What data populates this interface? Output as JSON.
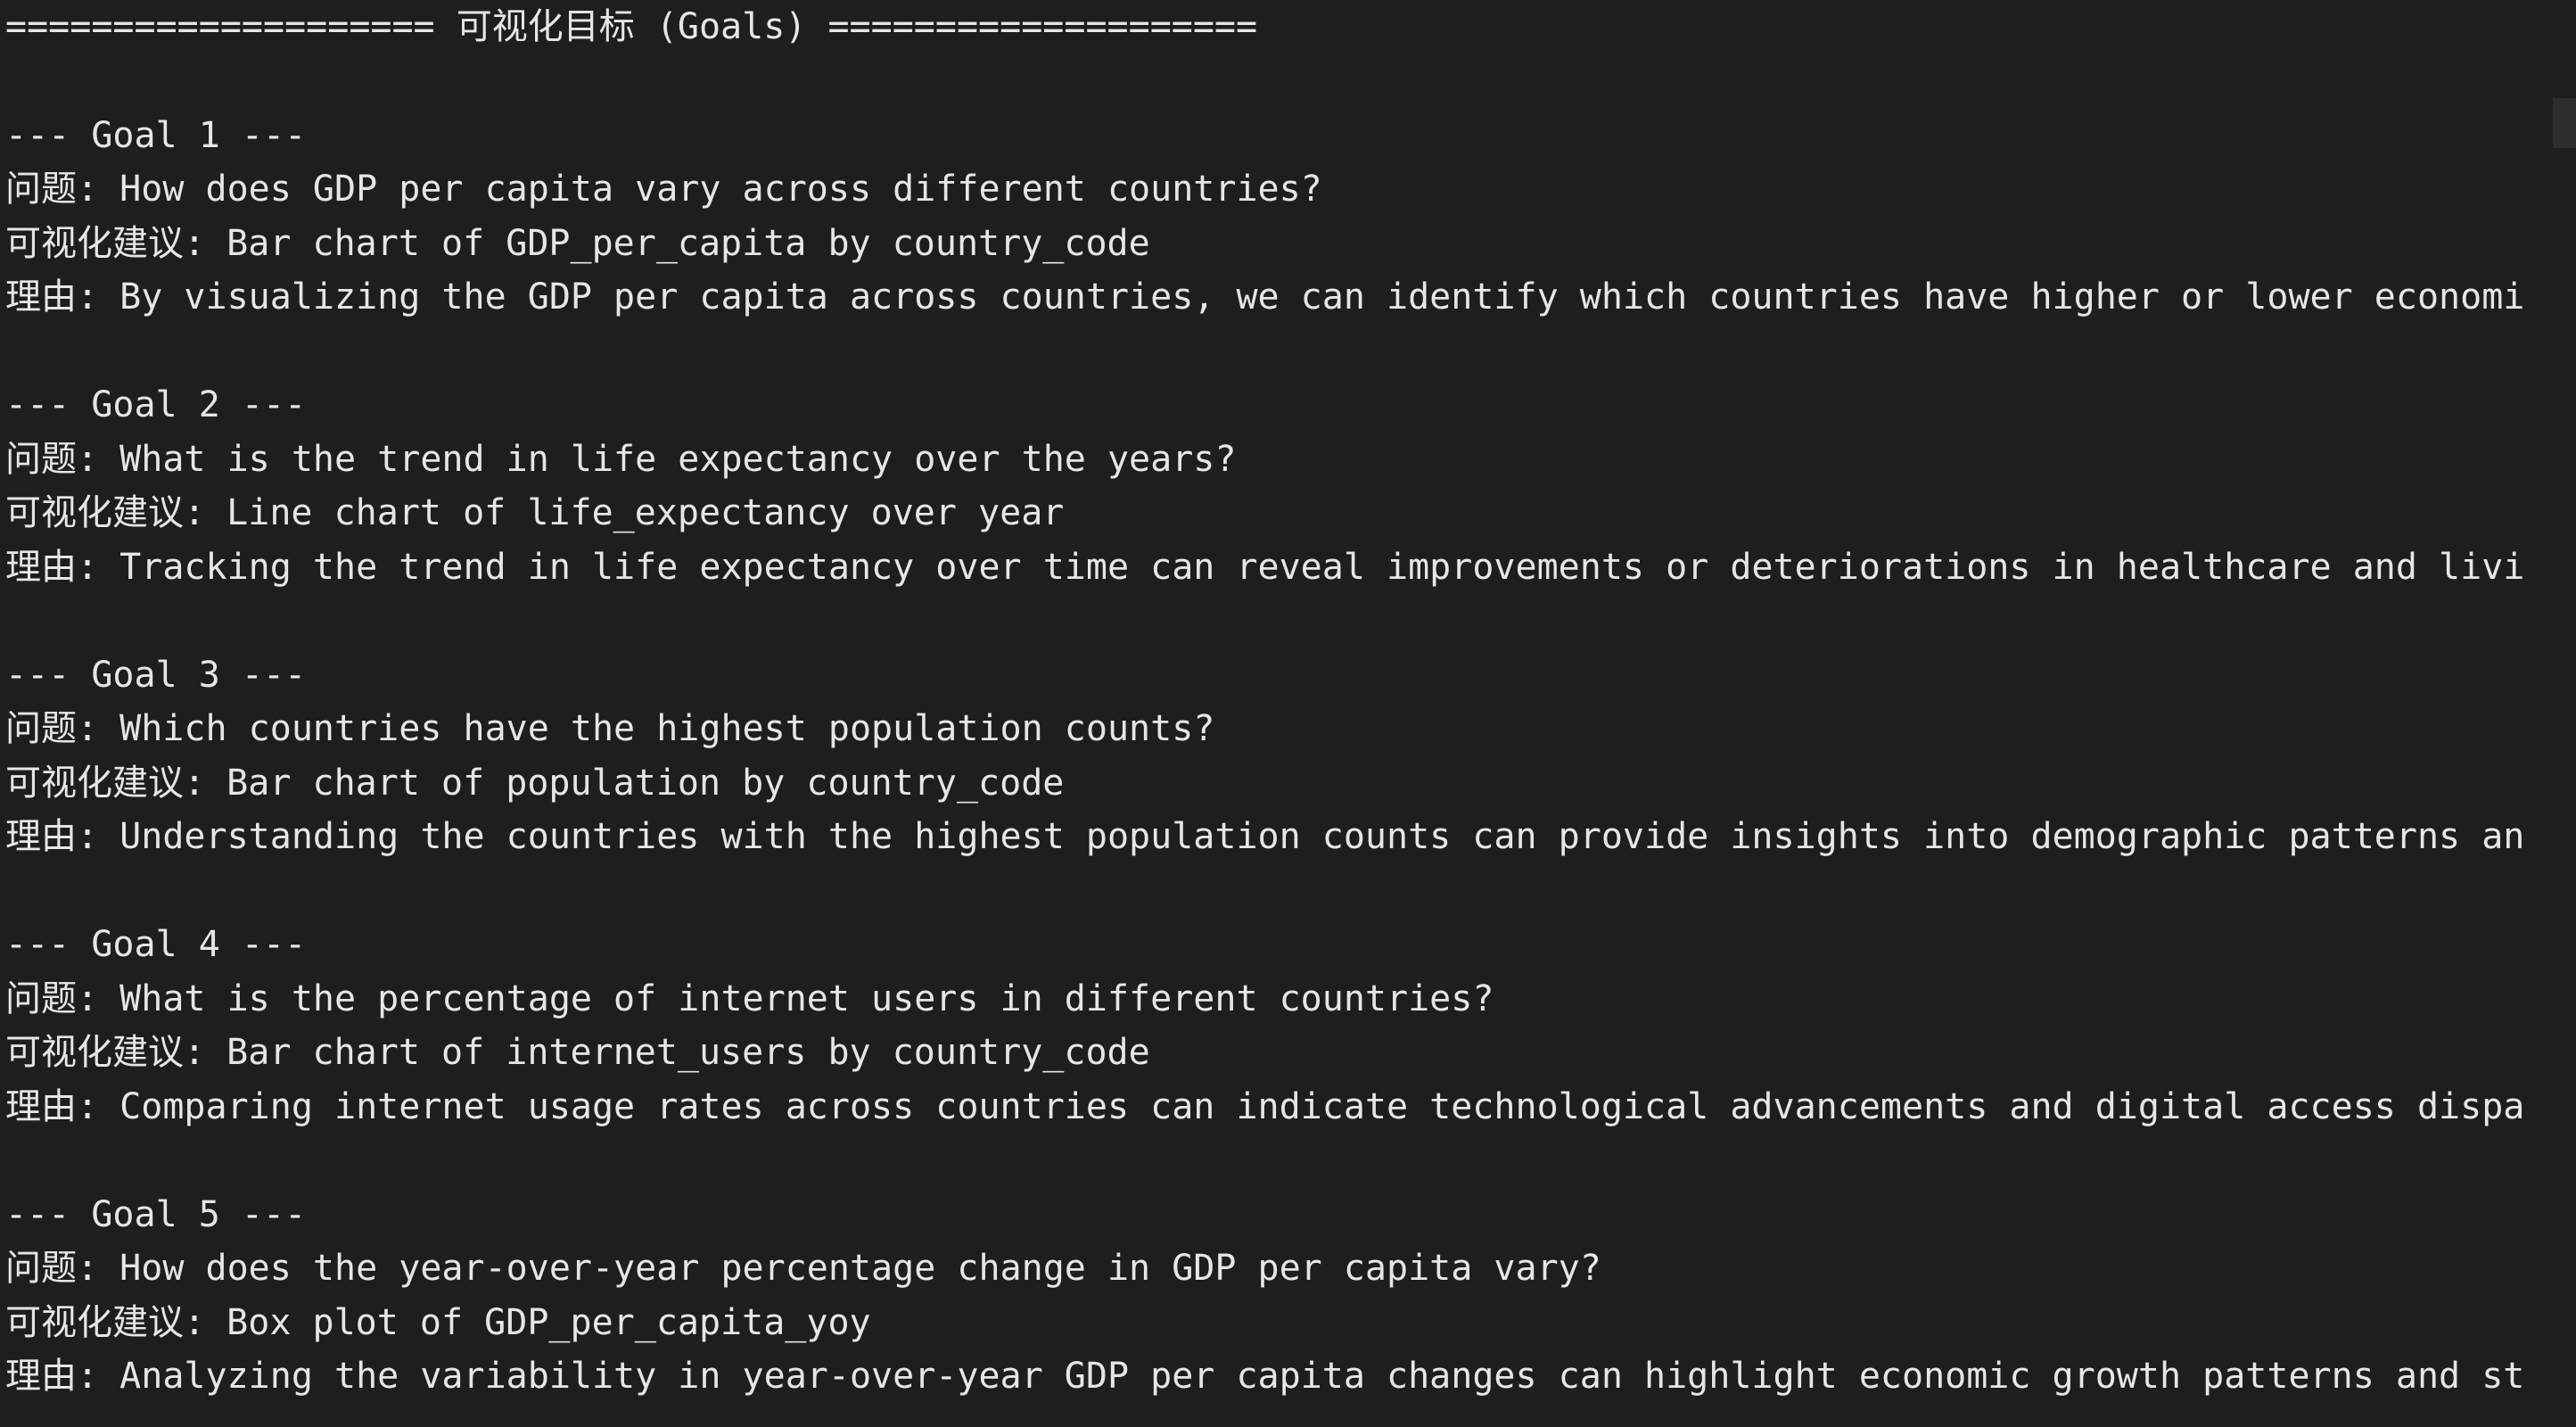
{
  "header": "==================== 可视化目标 (Goals) ====================",
  "goals": [
    {
      "heading": "--- Goal 1 ---",
      "question_label": "问题: ",
      "question": "How does GDP per capita vary across different countries?",
      "visualization_label": "可视化建议: ",
      "visualization": "Bar chart of GDP_per_capita by country_code",
      "rationale_label": "理由: ",
      "rationale": "By visualizing the GDP per capita across countries, we can identify which countries have higher or lower economi"
    },
    {
      "heading": "--- Goal 2 ---",
      "question_label": "问题: ",
      "question": "What is the trend in life expectancy over the years?",
      "visualization_label": "可视化建议: ",
      "visualization": "Line chart of life_expectancy over year",
      "rationale_label": "理由: ",
      "rationale": "Tracking the trend in life expectancy over time can reveal improvements or deteriorations in healthcare and livi"
    },
    {
      "heading": "--- Goal 3 ---",
      "question_label": "问题: ",
      "question": "Which countries have the highest population counts?",
      "visualization_label": "可视化建议: ",
      "visualization": "Bar chart of population by country_code",
      "rationale_label": "理由: ",
      "rationale": "Understanding the countries with the highest population counts can provide insights into demographic patterns an"
    },
    {
      "heading": "--- Goal 4 ---",
      "question_label": "问题: ",
      "question": "What is the percentage of internet users in different countries?",
      "visualization_label": "可视化建议: ",
      "visualization": "Bar chart of internet_users by country_code",
      "rationale_label": "理由: ",
      "rationale": "Comparing internet usage rates across countries can indicate technological advancements and digital access dispa"
    },
    {
      "heading": "--- Goal 5 ---",
      "question_label": "问题: ",
      "question": "How does the year-over-year percentage change in GDP per capita vary?",
      "visualization_label": "可视化建议: ",
      "visualization": "Box plot of GDP_per_capita_yoy",
      "rationale_label": "理由: ",
      "rationale": "Analyzing the variability in year-over-year GDP per capita changes can highlight economic growth patterns and st"
    }
  ]
}
